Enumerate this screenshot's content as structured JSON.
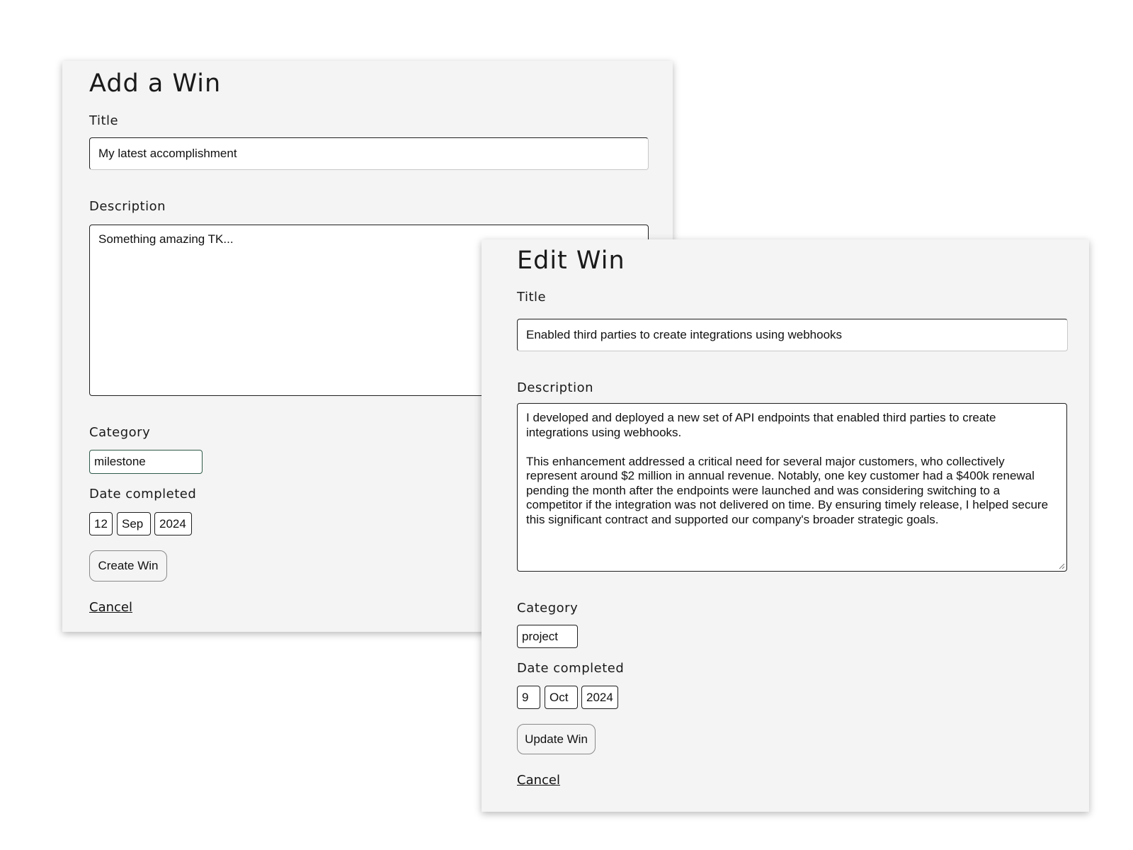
{
  "add_form": {
    "heading": "Add a Win",
    "title_label": "Title",
    "title_value": "My latest accomplishment",
    "description_label": "Description",
    "description_value": "Something amazing TK...",
    "category_label": "Category",
    "category_value": "milestone",
    "date_label": "Date completed",
    "date_day": "12",
    "date_month": "Sep",
    "date_year": "2024",
    "submit_label": "Create Win",
    "cancel_label": "Cancel"
  },
  "edit_form": {
    "heading": "Edit Win",
    "title_label": "Title",
    "title_value": "Enabled third parties to create integrations using webhooks",
    "description_label": "Description",
    "description_value": "I developed and deployed a new set of API endpoints that enabled third parties to create integrations using webhooks.\n\nThis enhancement addressed a critical need for several major customers, who collectively represent around $2 million in annual revenue. Notably, one key customer had a $400k renewal pending the month after the endpoints were launched and was considering switching to a competitor if the integration was not delivered on time. By ensuring timely release, I helped secure this significant contract and supported our company's broader strategic goals.",
    "category_label": "Category",
    "category_value": "project",
    "date_label": "Date completed",
    "date_day": "9",
    "date_month": "Oct",
    "date_year": "2024",
    "submit_label": "Update Win",
    "cancel_label": "Cancel"
  }
}
